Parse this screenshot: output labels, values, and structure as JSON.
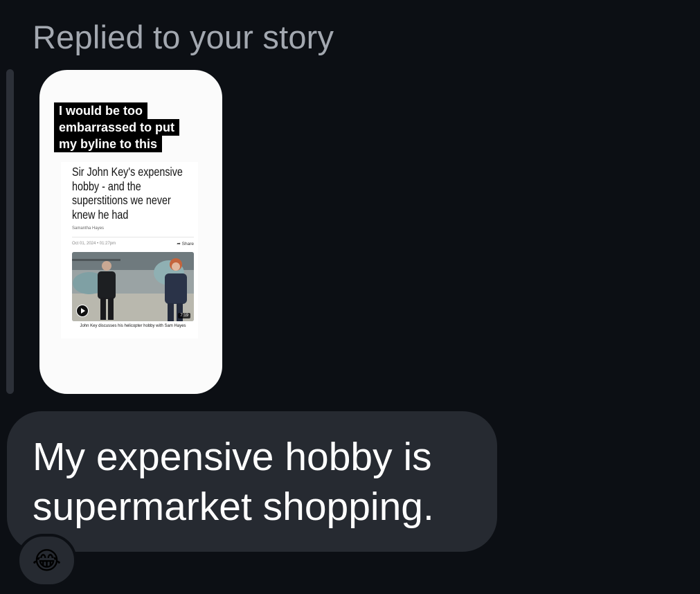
{
  "header": {
    "reply_label": "Replied to your story"
  },
  "story": {
    "caption_lines": [
      "I would be too",
      "embarrassed to put",
      "my byline to this"
    ],
    "article": {
      "headline": "Sir John Key's expensive hobby - and the superstitions we never knew he had",
      "author": "Samantha Hayes",
      "date": "Oct 01, 2024 • 01:27pm",
      "share_label": "Share",
      "video_duration": "7:19",
      "video_caption": "John Key discusses his helicopter hobby with Sam Hayes"
    }
  },
  "message": {
    "text": "My expensive hobby is supermarket shopping."
  },
  "reaction": {
    "emoji": "😂",
    "icon": "face-with-tears-of-joy-icon"
  },
  "colors": {
    "background": "#0c0f14",
    "bubble": "#262a31",
    "label": "#a3a8b0",
    "text": "#ffffff"
  }
}
